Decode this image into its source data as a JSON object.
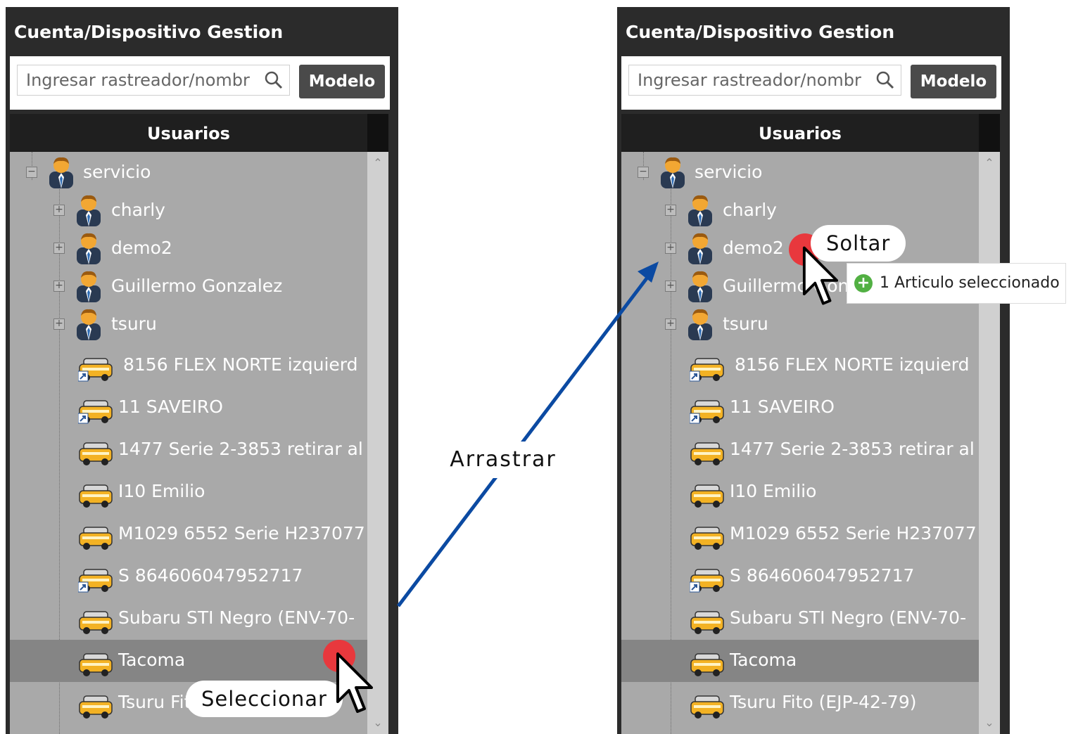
{
  "panels": [
    {
      "header": {
        "title": "Cuenta/Dispositivo Gestion"
      },
      "search": {
        "placeholder": "Ingresar rastreador/nombr"
      },
      "model_button": "Modelo",
      "column_header": "Usuarios",
      "tree": {
        "root": "servicio",
        "users": [
          "charly",
          "demo2",
          "Guillermo Gonzalez",
          "tsuru"
        ],
        "devices": [
          "8156 FLEX NORTE izquierd",
          "11 SAVEIRO",
          "1477 Serie 2-3853 retirar al",
          "I10 Emilio",
          "M1029 6552 Serie H237077",
          "S 864606047952717",
          "Subaru STI Negro (ENV-70-",
          "Tacoma",
          "Tsuru Fito (EJP-42-79)"
        ],
        "selected_device": "Tacoma"
      },
      "annotation": "Seleccionar"
    },
    {
      "header": {
        "title": "Cuenta/Dispositivo Gestion"
      },
      "search": {
        "placeholder": "Ingresar rastreador/nombr"
      },
      "model_button": "Modelo",
      "column_header": "Usuarios",
      "tree": {
        "root": "servicio",
        "users": [
          "charly",
          "demo2",
          "Guillermo Gonzalez",
          "tsuru"
        ],
        "devices": [
          "8156 FLEX NORTE izquierd",
          "11 SAVEIRO",
          "1477 Serie 2-3853 retirar al",
          "I10 Emilio",
          "M1029 6552 Serie H237077",
          "S 864606047952717",
          "Subaru STI Negro (ENV-70-",
          "Tacoma",
          "Tsuru Fito (EJP-42-79)"
        ],
        "selected_device": "Tacoma"
      },
      "annotation": "Soltar",
      "drag_tooltip": "1 Articulo seleccionado"
    }
  ],
  "arrow_label": "Arrastrar",
  "colors": {
    "panel_dark": "#2b2b2b",
    "tree_bg": "#a9a9a9",
    "selected_row": "#858585",
    "accent_dot": "#e8383d",
    "arrow": "#0b4aa2",
    "plus_green": "#52b043"
  }
}
